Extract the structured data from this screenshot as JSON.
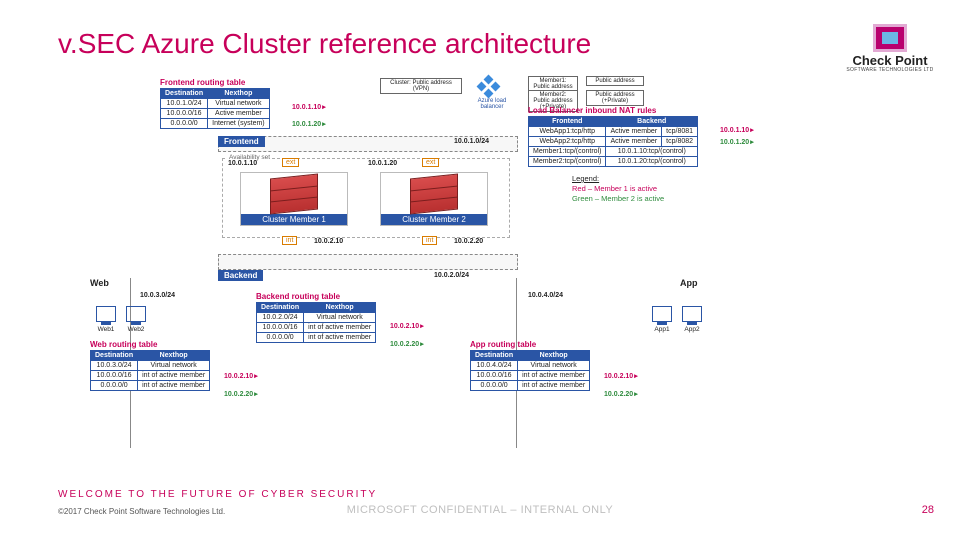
{
  "title": "v.SEC Azure Cluster reference architecture",
  "logo": {
    "name": "Check Point",
    "sub": "SOFTWARE TECHNOLOGIES LTD"
  },
  "footer": {
    "tagline": "WELCOME TO THE FUTURE OF CYBER SECURITY",
    "copyright": "©2017 Check Point Software Technologies Ltd.",
    "confidential": "MICROSOFT CONFIDENTIAL – INTERNAL ONLY",
    "page": "28"
  },
  "top_misc": {
    "cluster_box": "Cluster: Public address (VPN)",
    "mem_boxes": [
      [
        "Member1:",
        "Public address"
      ],
      [
        "Member2:",
        "Public address (+Private)"
      ]
    ],
    "lb_label": "Azure load balancer"
  },
  "frontend_rt": {
    "title": "Frontend routing table",
    "headers": [
      "Destination",
      "Nexthop"
    ],
    "rows": [
      [
        "10.0.1.0/24",
        "Virtual network"
      ],
      [
        "10.0.0.0/16",
        "Active member"
      ],
      [
        "0.0.0.0/0",
        "Internet (system)"
      ]
    ],
    "active_ip_red": "10.0.1.10",
    "active_ip_green": "10.0.1.20"
  },
  "nat_rt": {
    "title": "Load Balancer inbound NAT rules",
    "headers": [
      "Frontend",
      "Backend"
    ],
    "rows": [
      [
        "WebApp1:tcp/http",
        "Active member",
        "tcp/8081"
      ],
      [
        "WebApp2:tcp/http",
        "Active member",
        "tcp/8082"
      ],
      [
        "Member1:tcp/(control)",
        "10.0.1.10:tcp/(control)"
      ],
      [
        "Member2:tcp/(control)",
        "10.0.1.20:tcp/(control)"
      ]
    ],
    "right_red": "10.0.1.10",
    "right_green": "10.0.1.20"
  },
  "subnets": {
    "frontend": {
      "label": "Frontend",
      "cidr": "10.0.1.0/24"
    },
    "backend": {
      "label": "Backend",
      "cidr": "10.0.2.0/24"
    }
  },
  "avset": "Availability set",
  "members": {
    "m1": {
      "name": "Cluster Member 1",
      "ext_ip": "10.0.1.10",
      "int_ip": "10.0.2.10",
      "ext": "ext",
      "int": "int"
    },
    "m2": {
      "name": "Cluster Member 2",
      "ext_ip": "10.0.1.20",
      "int_ip": "10.0.2.20",
      "ext": "ext",
      "int": "int"
    }
  },
  "legend": {
    "title": "Legend:",
    "line1": "Red – Member 1 is active",
    "line2": "Green – Member 2 is active"
  },
  "tiers": {
    "web": {
      "label": "Web",
      "cidr": "10.0.3.0/24",
      "hosts": [
        "Web1",
        "Web2"
      ]
    },
    "app": {
      "label": "App",
      "cidr": "10.0.4.0/24",
      "hosts": [
        "App1",
        "App2"
      ]
    }
  },
  "backend_rt": {
    "title": "Backend routing table",
    "headers": [
      "Destination",
      "Nexthop"
    ],
    "rows": [
      [
        "10.0.2.0/24",
        "Virtual network"
      ],
      [
        "10.0.0.0/16",
        "int of active member"
      ],
      [
        "0.0.0.0/0",
        "int of active member"
      ]
    ],
    "right_red": "10.0.2.10",
    "right_green": "10.0.2.20"
  },
  "web_rt": {
    "title": "Web routing table",
    "headers": [
      "Destination",
      "Nexthop"
    ],
    "rows": [
      [
        "10.0.3.0/24",
        "Virtual network"
      ],
      [
        "10.0.0.0/16",
        "int of active member"
      ],
      [
        "0.0.0.0/0",
        "int of active member"
      ]
    ],
    "right_red": "10.0.2.10",
    "right_green": "10.0.2.20"
  },
  "app_rt": {
    "title": "App routing table",
    "headers": [
      "Destination",
      "Nexthop"
    ],
    "rows": [
      [
        "10.0.4.0/24",
        "Virtual network"
      ],
      [
        "10.0.0.0/16",
        "int of active member"
      ],
      [
        "0.0.0.0/0",
        "int of active member"
      ]
    ],
    "right_red": "10.0.2.10",
    "right_green": "10.0.2.20"
  }
}
